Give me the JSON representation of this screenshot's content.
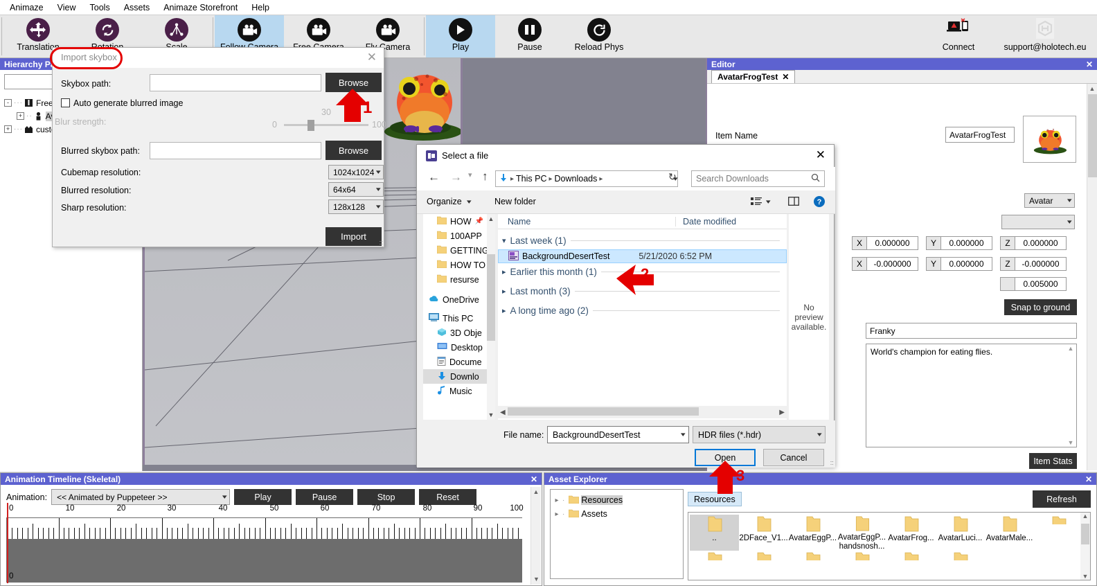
{
  "app": {
    "menu": [
      "Animaze",
      "View",
      "Tools",
      "Assets",
      "Animaze Storefront",
      "Help"
    ]
  },
  "toolbar": {
    "buttons": [
      {
        "label": "Translation",
        "icon": "move-icon",
        "active": false
      },
      {
        "label": "Rotation",
        "icon": "rotate-icon",
        "active": false
      },
      {
        "label": "Scale",
        "icon": "scale-icon",
        "active": false
      },
      {
        "label": "Follow Camera",
        "icon": "camera-icon",
        "active": true
      },
      {
        "label": "Free Camera",
        "icon": "camera-icon",
        "active": false
      },
      {
        "label": "Fly Camera",
        "icon": "camera-icon",
        "active": false
      },
      {
        "label": "Play",
        "icon": "play-icon",
        "active": true
      },
      {
        "label": "Pause",
        "icon": "pause-icon",
        "active": false
      },
      {
        "label": "Reload Phys",
        "icon": "reload-icon",
        "active": false
      }
    ],
    "connect_label": "Connect",
    "support_label": "support@holotech.eu"
  },
  "hierarchy": {
    "title": "Hierarchy Pa",
    "search_value": "",
    "items": [
      {
        "label": "Free Ite",
        "toggle": "-",
        "icon": "item-icon",
        "depth": 0
      },
      {
        "label": "Ava",
        "toggle": "+",
        "icon": "avatar-icon",
        "depth": 1,
        "selected": true
      },
      {
        "label": "custom",
        "toggle": "+",
        "icon": "scene-icon",
        "depth": 0
      }
    ]
  },
  "editor": {
    "title": "Editor",
    "tab_label": "AvatarFrogTest",
    "tab_close": "✕",
    "item_name_label": "Item Name",
    "item_name_value": "AvatarFrogTest",
    "type_combo": "Avatar",
    "secondary_combo": "",
    "position": {
      "x_label": "X",
      "x": "0.000000",
      "y_label": "Y",
      "y": "0.000000",
      "z_label": "Z",
      "z": "0.000000"
    },
    "rotation": {
      "x_label": "X",
      "x": "-0.000000",
      "y_label": "Y",
      "y": "0.000000",
      "z_label": "Z",
      "z": "-0.000000"
    },
    "scale_value": "0.005000",
    "snap_button": "Snap to ground",
    "display_name": "Franky",
    "description": "World's champion for eating flies.",
    "item_stats_button": "Item Stats"
  },
  "timeline": {
    "title": "Animation Timeline (Skeletal)",
    "animation_label": "Animation:",
    "animation_value": "<< Animated by Puppeteer >>",
    "buttons": [
      "Play",
      "Pause",
      "Stop",
      "Reset"
    ],
    "ticks": [
      "0",
      "10",
      "20",
      "30",
      "40",
      "50",
      "60",
      "70",
      "80",
      "90",
      "100"
    ],
    "track_label": "0"
  },
  "asset_explorer": {
    "title": "Asset Explorer",
    "tree": [
      {
        "label": "Resources",
        "selected": true
      },
      {
        "label": "Assets",
        "selected": false
      }
    ],
    "breadcrumb": "Resources",
    "refresh_label": "Refresh",
    "items": [
      {
        "caption": "..",
        "selected": true
      },
      {
        "caption": "2DFace_V1...",
        "selected": false
      },
      {
        "caption": "AvatarEggP...",
        "selected": false
      },
      {
        "caption": "AvatarEggP... handsnosh...",
        "selected": false
      },
      {
        "caption": "AvatarFrog...",
        "selected": false
      },
      {
        "caption": "AvatarLuci...",
        "selected": false
      },
      {
        "caption": "AvatarMale...",
        "selected": false
      }
    ]
  },
  "skybox_dialog": {
    "title": "Import skybox",
    "close": "✕",
    "skybox_path_label": "Skybox path:",
    "skybox_path_value": "",
    "browse_label": "Browse",
    "auto_blur_label": "Auto generate blurred image",
    "auto_blur_checked": false,
    "blur_strength_label": "Blur strength:",
    "blur_min": "0",
    "blur_max": "100",
    "blur_value": "30",
    "blurred_path_label": "Blurred skybox path:",
    "blurred_path_value": "",
    "browse2_label": "Browse",
    "cubemap_label": "Cubemap resolution:",
    "cubemap_value": "1024x1024",
    "blurred_res_label": "Blurred resolution:",
    "blurred_res_value": "64x64",
    "sharp_res_label": "Sharp resolution:",
    "sharp_res_value": "128x128",
    "import_label": "Import"
  },
  "file_dialog": {
    "title": "Select a file",
    "close": "✕",
    "path_parts": [
      "This PC",
      "Downloads"
    ],
    "search_placeholder": "Search Downloads",
    "organize_label": "Organize",
    "new_folder_label": "New folder",
    "col_name": "Name",
    "col_date": "Date modified",
    "nav_items": [
      {
        "label": "HOW",
        "icon": "folder-icon",
        "pinned": true,
        "indent": true
      },
      {
        "label": "100APP",
        "icon": "folder-icon",
        "indent": true
      },
      {
        "label": "GETTING",
        "icon": "folder-icon",
        "indent": true
      },
      {
        "label": "HOW TO",
        "icon": "folder-icon",
        "indent": true
      },
      {
        "label": "resurse",
        "icon": "folder-icon",
        "indent": true
      },
      {
        "label": "OneDrive",
        "icon": "cloud-icon",
        "indent": false
      },
      {
        "label": "This PC",
        "icon": "pc-icon",
        "indent": false
      },
      {
        "label": "3D Obje",
        "icon": "3dobjects-icon",
        "indent": true
      },
      {
        "label": "Desktop",
        "icon": "desktop-icon",
        "indent": true
      },
      {
        "label": "Docume",
        "icon": "documents-icon",
        "indent": true
      },
      {
        "label": "Downlo",
        "icon": "downloads-icon",
        "indent": true,
        "selected": true
      },
      {
        "label": "Music",
        "icon": "music-icon",
        "indent": true
      }
    ],
    "groups": [
      {
        "label": "Last week (1)",
        "expanded": true
      },
      {
        "label": "Earlier this month (1)",
        "expanded": false
      },
      {
        "label": "Last month (3)",
        "expanded": false
      },
      {
        "label": "A long time ago (2)",
        "expanded": false
      }
    ],
    "file_row": {
      "name": "BackgroundDesertTest",
      "date": "5/21/2020 6:52 PM"
    },
    "preview_text": "No preview available.",
    "file_name_label": "File name:",
    "file_name_value": "BackgroundDesertTest",
    "filter_value": "HDR files (*.hdr)",
    "open_label": "Open",
    "cancel_label": "Cancel"
  },
  "annotations": [
    {
      "number": "1"
    },
    {
      "number": "2"
    },
    {
      "number": "3"
    }
  ],
  "colors": {
    "panel_title": "#5d62d0",
    "toolbar_active": "#b8d8f0",
    "annotation_red": "#e40000",
    "accent_blue": "#0078d7",
    "selection_blue": "#cce8ff"
  }
}
